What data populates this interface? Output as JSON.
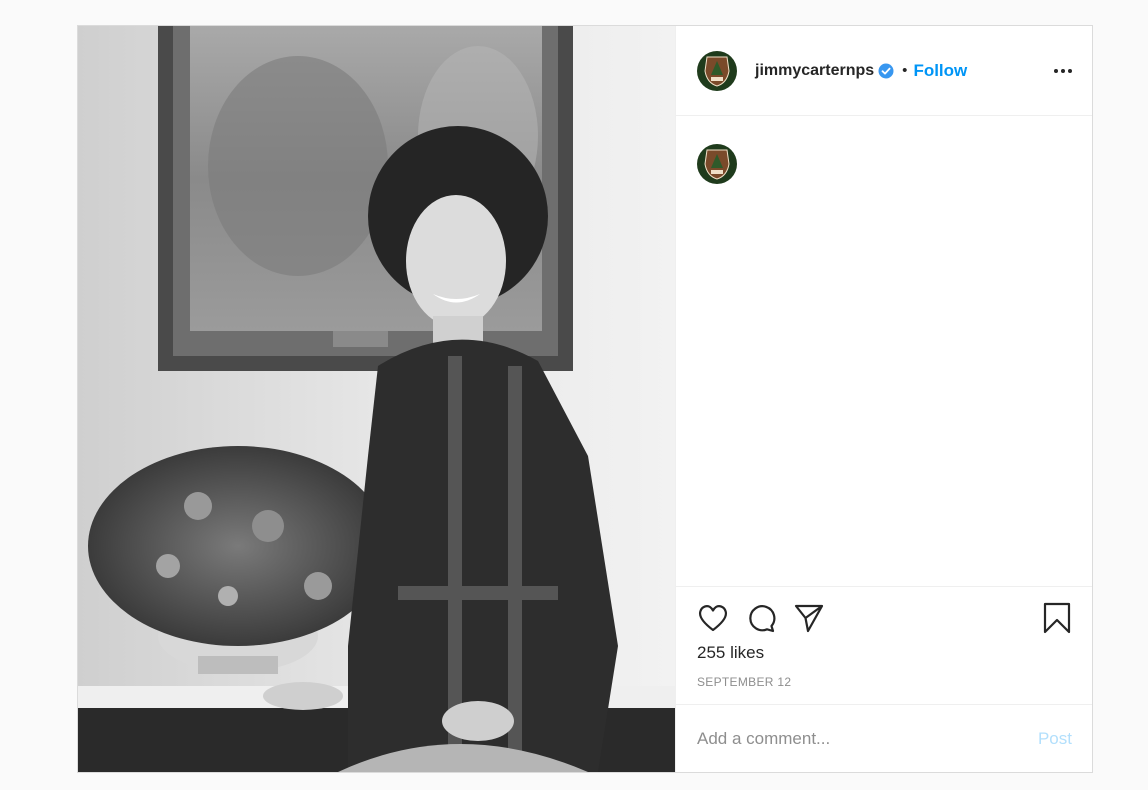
{
  "post": {
    "username": "jimmycarternps",
    "follow_label": "Follow",
    "separator": "•",
    "likes": "255 likes",
    "date": "SEPTEMBER 12",
    "comment_placeholder": "Add a comment...",
    "post_label": "Post"
  },
  "icons": {
    "avatar": "nps-arrowhead-icon",
    "verified": "verified-badge-icon",
    "more": "more-options-icon",
    "like": "heart-icon",
    "comment": "comment-icon",
    "share": "paper-plane-icon",
    "save": "bookmark-icon"
  },
  "colors": {
    "accent": "#0095f6",
    "post_disabled": "#b2dffc",
    "text": "#262626",
    "muted": "#8e8e8e"
  }
}
